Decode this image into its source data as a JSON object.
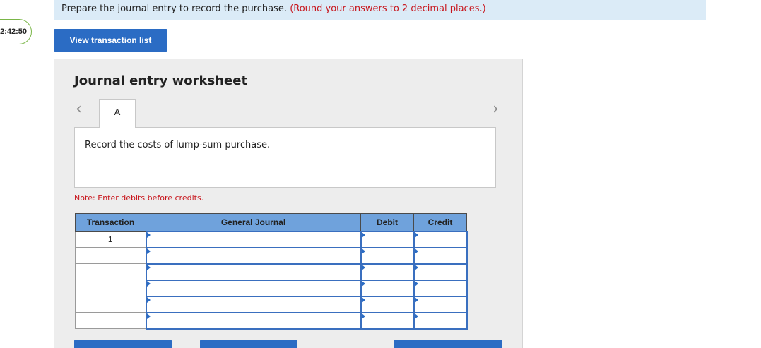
{
  "timer": "2:42:50",
  "instruction": {
    "text": "Prepare the journal entry to record the purchase.",
    "note": "(Round your answers to 2 decimal places.)"
  },
  "buttons": {
    "view_transaction_list": "View transaction list"
  },
  "worksheet": {
    "title": "Journal entry worksheet",
    "tab_label": "A",
    "description": "Record the costs of lump-sum purchase.",
    "note": "Note: Enter debits before credits."
  },
  "journal_table": {
    "headers": [
      "Transaction",
      "General Journal",
      "Debit",
      "Credit"
    ],
    "rows": [
      {
        "transaction": "1",
        "account": "",
        "debit": "",
        "credit": ""
      },
      {
        "transaction": "",
        "account": "",
        "debit": "",
        "credit": ""
      },
      {
        "transaction": "",
        "account": "",
        "debit": "",
        "credit": ""
      },
      {
        "transaction": "",
        "account": "",
        "debit": "",
        "credit": ""
      },
      {
        "transaction": "",
        "account": "",
        "debit": "",
        "credit": ""
      },
      {
        "transaction": "",
        "account": "",
        "debit": "",
        "credit": ""
      }
    ]
  },
  "icons": {
    "prev": "chevron-left-icon",
    "next": "chevron-right-icon"
  },
  "colors": {
    "accent": "#2b6cc4",
    "header_fill": "#6fa2dc",
    "instruction_bg": "#dbebf7",
    "alert": "#c8161d"
  }
}
